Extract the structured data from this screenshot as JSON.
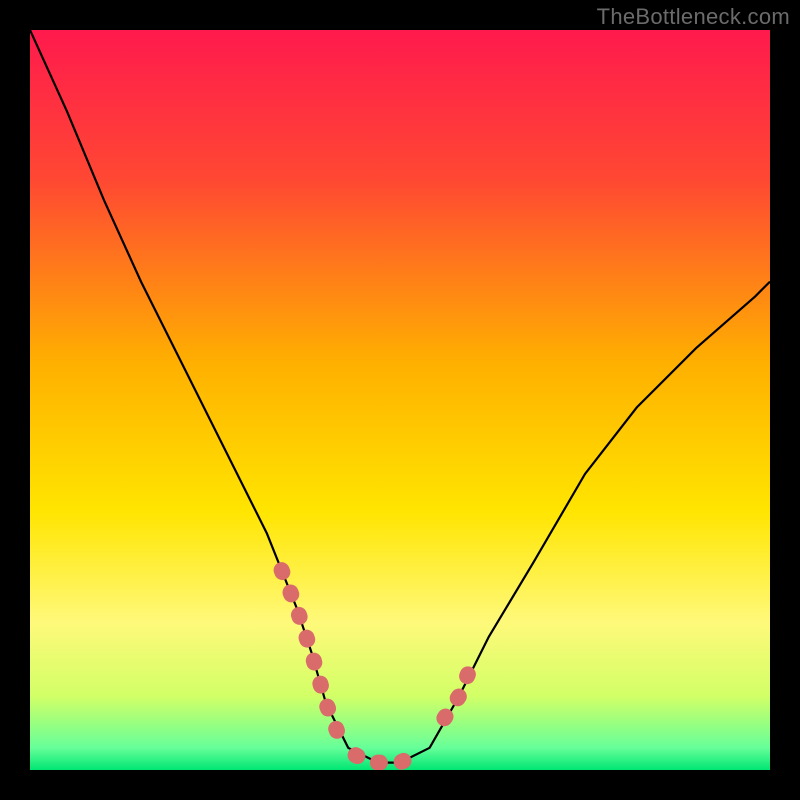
{
  "watermark": "TheBottleneck.com",
  "chart_data": {
    "type": "line",
    "title": "",
    "xlabel": "",
    "ylabel": "",
    "xlim": [
      0,
      100
    ],
    "ylim": [
      0,
      100
    ],
    "grid": false,
    "legend": false,
    "background_gradient": {
      "direction": "vertical",
      "stops": [
        {
          "pos": 0.0,
          "color": "#ff1a4d"
        },
        {
          "pos": 0.2,
          "color": "#ff4733"
        },
        {
          "pos": 0.45,
          "color": "#ffb000"
        },
        {
          "pos": 0.65,
          "color": "#ffe500"
        },
        {
          "pos": 0.8,
          "color": "#fff97a"
        },
        {
          "pos": 0.9,
          "color": "#d2ff66"
        },
        {
          "pos": 0.97,
          "color": "#66ff99"
        },
        {
          "pos": 1.0,
          "color": "#00e673"
        }
      ]
    },
    "series": [
      {
        "name": "bottleneck-curve",
        "color": "#000000",
        "x": [
          0,
          5,
          10,
          15,
          20,
          25,
          28,
          32,
          36,
          38,
          40,
          43,
          47,
          50,
          54,
          58,
          62,
          68,
          75,
          82,
          90,
          98,
          100
        ],
        "y": [
          100,
          89,
          77,
          66,
          56,
          46,
          40,
          32,
          22,
          16,
          9,
          3,
          1,
          1,
          3,
          10,
          18,
          28,
          40,
          49,
          57,
          64,
          66
        ]
      }
    ],
    "highlights": [
      {
        "name": "left-slope-marker",
        "color": "#d96b6b",
        "x": [
          34,
          36,
          38,
          40,
          42
        ],
        "y": [
          27,
          22,
          16,
          9,
          4
        ]
      },
      {
        "name": "valley-floor-marker",
        "color": "#d96b6b",
        "x": [
          44,
          46,
          48,
          50,
          52
        ],
        "y": [
          2,
          1,
          1,
          1,
          2
        ]
      },
      {
        "name": "right-slope-marker",
        "color": "#d96b6b",
        "x": [
          56,
          58,
          60
        ],
        "y": [
          7,
          10,
          15
        ]
      }
    ]
  }
}
